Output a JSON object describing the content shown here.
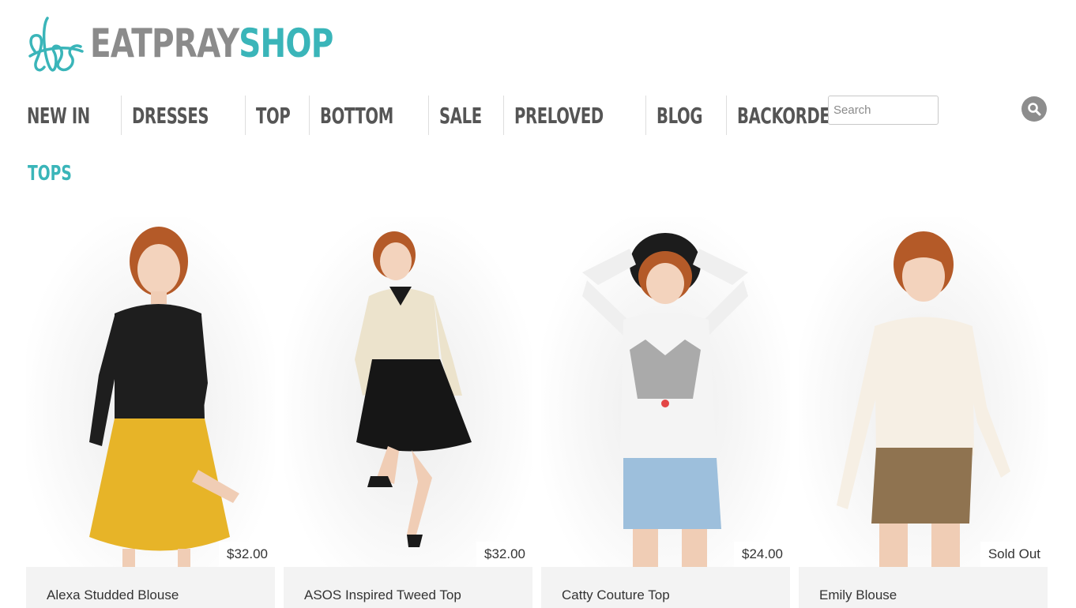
{
  "brand": {
    "name_part1": "EATPRAY",
    "name_part2": "SHOP",
    "mark": "eps-monogram-logo"
  },
  "nav": {
    "items": [
      {
        "label": "NEW IN"
      },
      {
        "label": "DRESSES"
      },
      {
        "label": "TOP"
      },
      {
        "label": "BOTTOM"
      },
      {
        "label": "SALE"
      },
      {
        "label": "PRELOVED"
      },
      {
        "label": "BLOG"
      },
      {
        "label": "BACKORDER"
      }
    ]
  },
  "search": {
    "placeholder": "Search",
    "value": "",
    "icon": "magnifier-icon"
  },
  "section": {
    "title": "TOPS"
  },
  "products": [
    {
      "name": "Alexa Studded Blouse",
      "price": "$32.00"
    },
    {
      "name": "ASOS Inspired Tweed Top",
      "price": "$32.00"
    },
    {
      "name": "Catty Couture Top",
      "price": "$24.00"
    },
    {
      "name": "Emily Blouse",
      "price": "Sold Out"
    }
  ],
  "colors": {
    "accent": "#3ab5b9",
    "brand_gray": "#8b8b8b",
    "nav_text": "#555555",
    "card_bg": "#f3f3f3"
  }
}
